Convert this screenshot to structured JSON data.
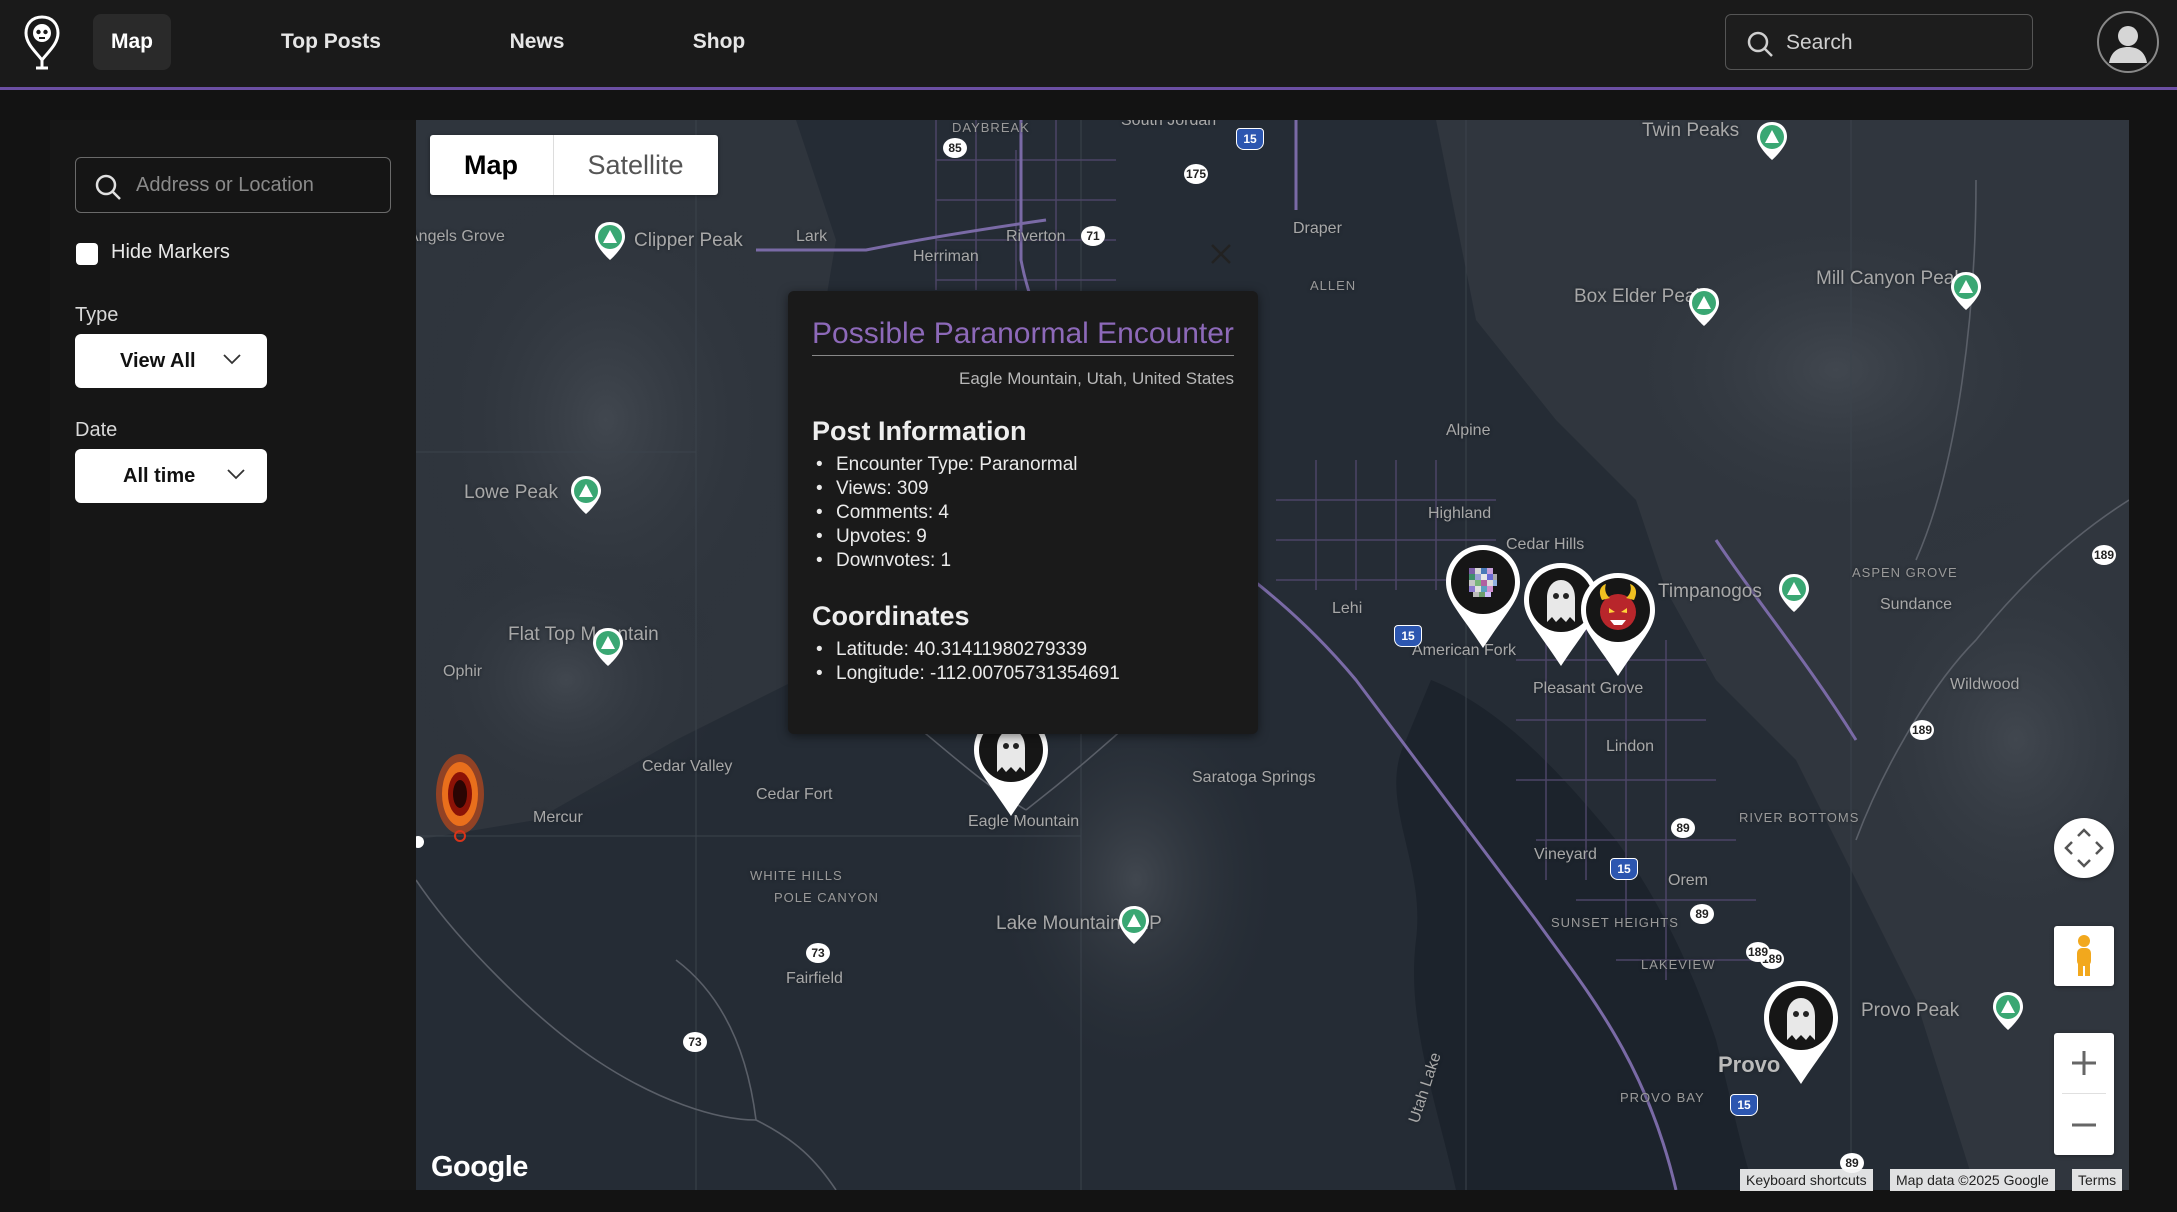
{
  "nav": {
    "items": [
      {
        "label": "Map",
        "active": true
      },
      {
        "label": "Top Posts",
        "active": false
      },
      {
        "label": "News",
        "active": false
      },
      {
        "label": "Shop",
        "active": false
      }
    ],
    "search_placeholder": "Search",
    "accent": "#6b4fa3"
  },
  "sidebar": {
    "address_placeholder": "Address or Location",
    "hide_markers_label": "Hide Markers",
    "type_label": "Type",
    "type_value": "View All",
    "date_label": "Date",
    "date_value": "All time"
  },
  "map": {
    "type_controls": [
      "Map",
      "Satellite"
    ],
    "selected_type": "Map",
    "places": [
      "Twin Peaks",
      "Mill Canyon Peak",
      "Box Elder Peak",
      "Clipper Peak",
      "Lark",
      "Riverton",
      "Herriman",
      "Draper",
      "South Jordan",
      "Angels Grove",
      "Lowe Peak",
      "Flat Top Mountain",
      "Ophir",
      "Cedar Valley",
      "Cedar Fort",
      "Mercur",
      "Eagle Mountain",
      "Saratoga Springs",
      "Lehi",
      "Highland",
      "Alpine",
      "Cedar Hills",
      "American Fork",
      "Pleasant Grove",
      "Timpanogos",
      "Sundance",
      "Wildwood",
      "Lindon",
      "Vineyard",
      "Orem",
      "Lake Mountains HP",
      "Fairfield",
      "Provo",
      "Provo Peak",
      "Utah Lake",
      "ASPEN GROVE",
      "RIVER BOTTOMS",
      "SUNSET HEIGHTS",
      "LAKEVIEW",
      "PROVO BAY",
      "WHITE HILLS",
      "POLE CANYON",
      "DAYBREAK",
      "ALLEN"
    ],
    "route_shields": [
      "85",
      "15",
      "175",
      "71",
      "15",
      "189",
      "189",
      "189",
      "89",
      "15",
      "89",
      "189",
      "15",
      "73",
      "73",
      "89"
    ],
    "attribution": [
      "Keyboard shortcuts",
      "Map data ©2025 Google",
      "Terms"
    ],
    "logo_text": "Google"
  },
  "popup": {
    "title": "Possible Paranormal Encounter",
    "location": "Eagle Mountain, Utah, United States",
    "post_info_heading": "Post Information",
    "post_info": [
      "Encounter Type: Paranormal",
      "Views: 309",
      "Comments: 4",
      "Upvotes: 9",
      "Downvotes: 1"
    ],
    "coords_heading": "Coordinates",
    "coords": [
      "Latitude: 40.31411980279339",
      "Longitude: -112.00705731354691"
    ],
    "title_color": "#8d69b9"
  },
  "markers": [
    "ghost-marker",
    "ghost-marker",
    "pixel-marker",
    "ghost-marker",
    "demon-marker",
    "ghost-marker",
    "fire-portal-marker"
  ]
}
